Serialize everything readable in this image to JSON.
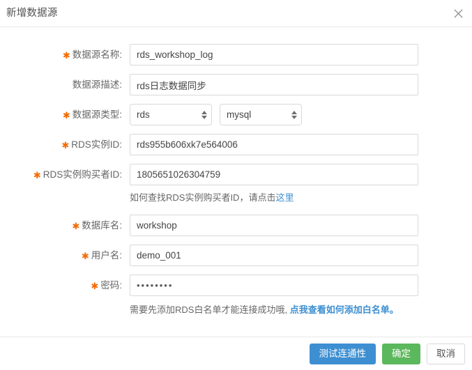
{
  "dialog": {
    "title": "新增数据源",
    "close_icon": "close-icon"
  },
  "form": {
    "fields": [
      {
        "label": "数据源名称:",
        "required": true,
        "type": "text",
        "value": "rds_workshop_log",
        "placeholder": ""
      },
      {
        "label": "数据源描述:",
        "required": false,
        "type": "text",
        "value": "rds日志数据同步",
        "placeholder": ""
      },
      {
        "label": "数据源类型:",
        "required": true,
        "type": "select-pair",
        "value": "rds",
        "value2": "mysql"
      },
      {
        "label": "RDS实例ID:",
        "required": true,
        "type": "text",
        "value": "rds955b606xk7e564006",
        "placeholder": ""
      },
      {
        "label": "RDS实例购买者ID:",
        "required": true,
        "type": "text",
        "value": "1805651026304759",
        "placeholder": ""
      },
      {
        "label": "数据库名:",
        "required": true,
        "type": "text",
        "value": "workshop",
        "placeholder": ""
      },
      {
        "label": "用户名:",
        "required": true,
        "type": "text",
        "value": "demo_001",
        "placeholder": ""
      },
      {
        "label": "密码:",
        "required": true,
        "type": "password",
        "value": "••••••••",
        "placeholder": ""
      }
    ],
    "hint_purchaser": {
      "text": "如何查找RDS实例购买者ID，请点击",
      "link": "这里"
    },
    "hint_whitelist": {
      "text": "需要先添加RDS白名单才能连接成功哦,",
      "link": "点我查看如何添加白名单。"
    }
  },
  "footer": {
    "test_label": "测试连通性",
    "confirm_label": "确定",
    "cancel_label": "取消"
  },
  "colors": {
    "primary": "#3d8fd1",
    "success": "#5cb85c",
    "required_star": "#f56a00",
    "link": "#3d8fd1",
    "border": "#d9d9d9"
  }
}
